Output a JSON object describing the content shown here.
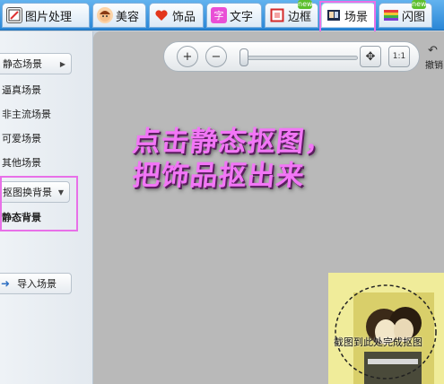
{
  "tabs": [
    {
      "label": "图片处理",
      "icon": "photo-edit-icon",
      "new": false,
      "active": false
    },
    {
      "label": "美容",
      "icon": "face-icon",
      "new": false,
      "active": false
    },
    {
      "label": "饰品",
      "icon": "heart-icon",
      "new": false,
      "active": false
    },
    {
      "label": "文字",
      "icon": "text-icon",
      "icon_char": "字",
      "new": false,
      "active": false
    },
    {
      "label": "边框",
      "icon": "frame-icon",
      "new": true,
      "active": false
    },
    {
      "label": "场景",
      "icon": "scene-icon",
      "new": false,
      "active": true
    },
    {
      "label": "闪图",
      "icon": "rainbow-icon",
      "new": true,
      "active": false
    }
  ],
  "badge_label": "new",
  "sidebar": {
    "collapse_button": "静态场景",
    "items": [
      "逼真场景",
      "非主流场景",
      "可爱场景",
      "其他场景"
    ],
    "cutout_dropdown": "抠图换背景",
    "cutout_item": "静态背景",
    "import_button": "导入场景"
  },
  "toolbar": {
    "zoom_in": "+",
    "zoom_out": "−",
    "fit": "✥",
    "actual_size": "1:1",
    "undo_label": "撤销",
    "zoom_level": 0.0
  },
  "overlay": {
    "line1": "点击静态抠图，",
    "line2": "把饰品抠出来"
  },
  "thumbnail": {
    "caption": "截图到此处完成抠图"
  },
  "colors": {
    "highlight": "#e870e8",
    "tab_bar": "#2a86d6",
    "overlay_text": "#f276f6",
    "canvas": "#b9b9b9"
  }
}
